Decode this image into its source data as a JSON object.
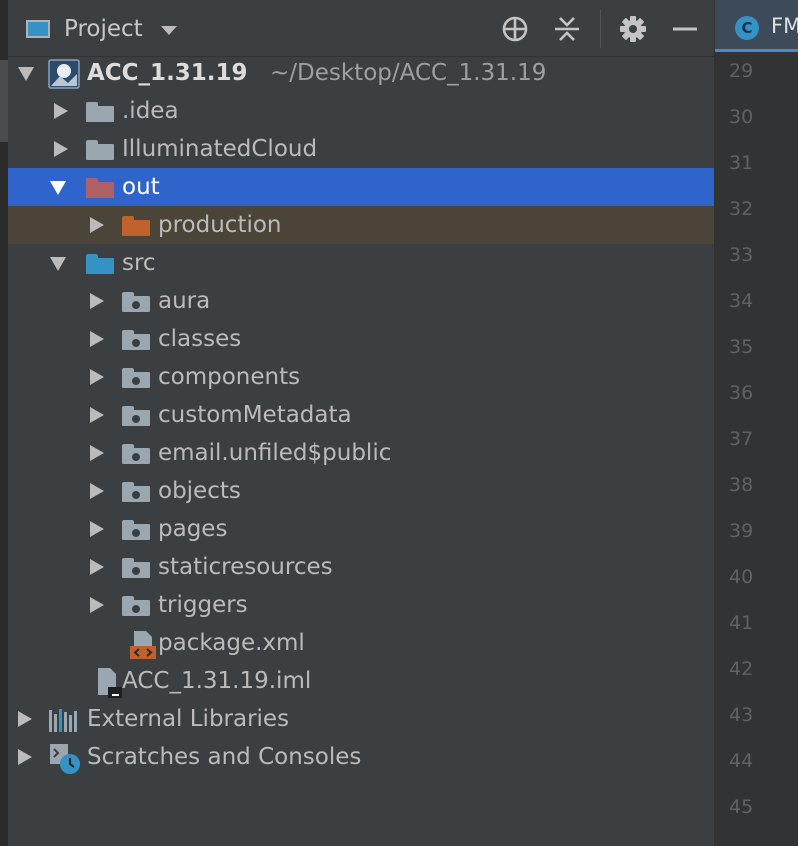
{
  "panel": {
    "title": "Project",
    "tools": [
      "locate-icon",
      "collapse-all-icon",
      "gear-icon",
      "hide-icon"
    ]
  },
  "tree": {
    "root": {
      "name": "ACC_1.31.19",
      "path": "~/Desktop/ACC_1.31.19"
    },
    "idea": ".idea",
    "illuminated": "IlluminatedCloud",
    "out": "out",
    "production": "production",
    "src": "src",
    "src_children": [
      "aura",
      "classes",
      "components",
      "customMetadata",
      "email.unfiled$public",
      "objects",
      "pages",
      "staticresources",
      "triggers"
    ],
    "package": "package.xml",
    "iml": "ACC_1.31.19.iml",
    "external": "External Libraries",
    "scratches": "Scratches and Consoles"
  },
  "editor": {
    "tab_icon": "C",
    "tab_label": "FM",
    "line_numbers": [
      "29",
      "30",
      "31",
      "32",
      "33",
      "34",
      "35",
      "36",
      "37",
      "38",
      "39",
      "40",
      "41",
      "42",
      "43",
      "44",
      "45"
    ]
  },
  "colors": {
    "selection": "#2f65ca",
    "excluded_bg": "#4a4538",
    "folder_gray": "#9aa7b0",
    "folder_excluded": "#b06166",
    "folder_orange": "#c0622b",
    "folder_source": "#3592c4"
  }
}
